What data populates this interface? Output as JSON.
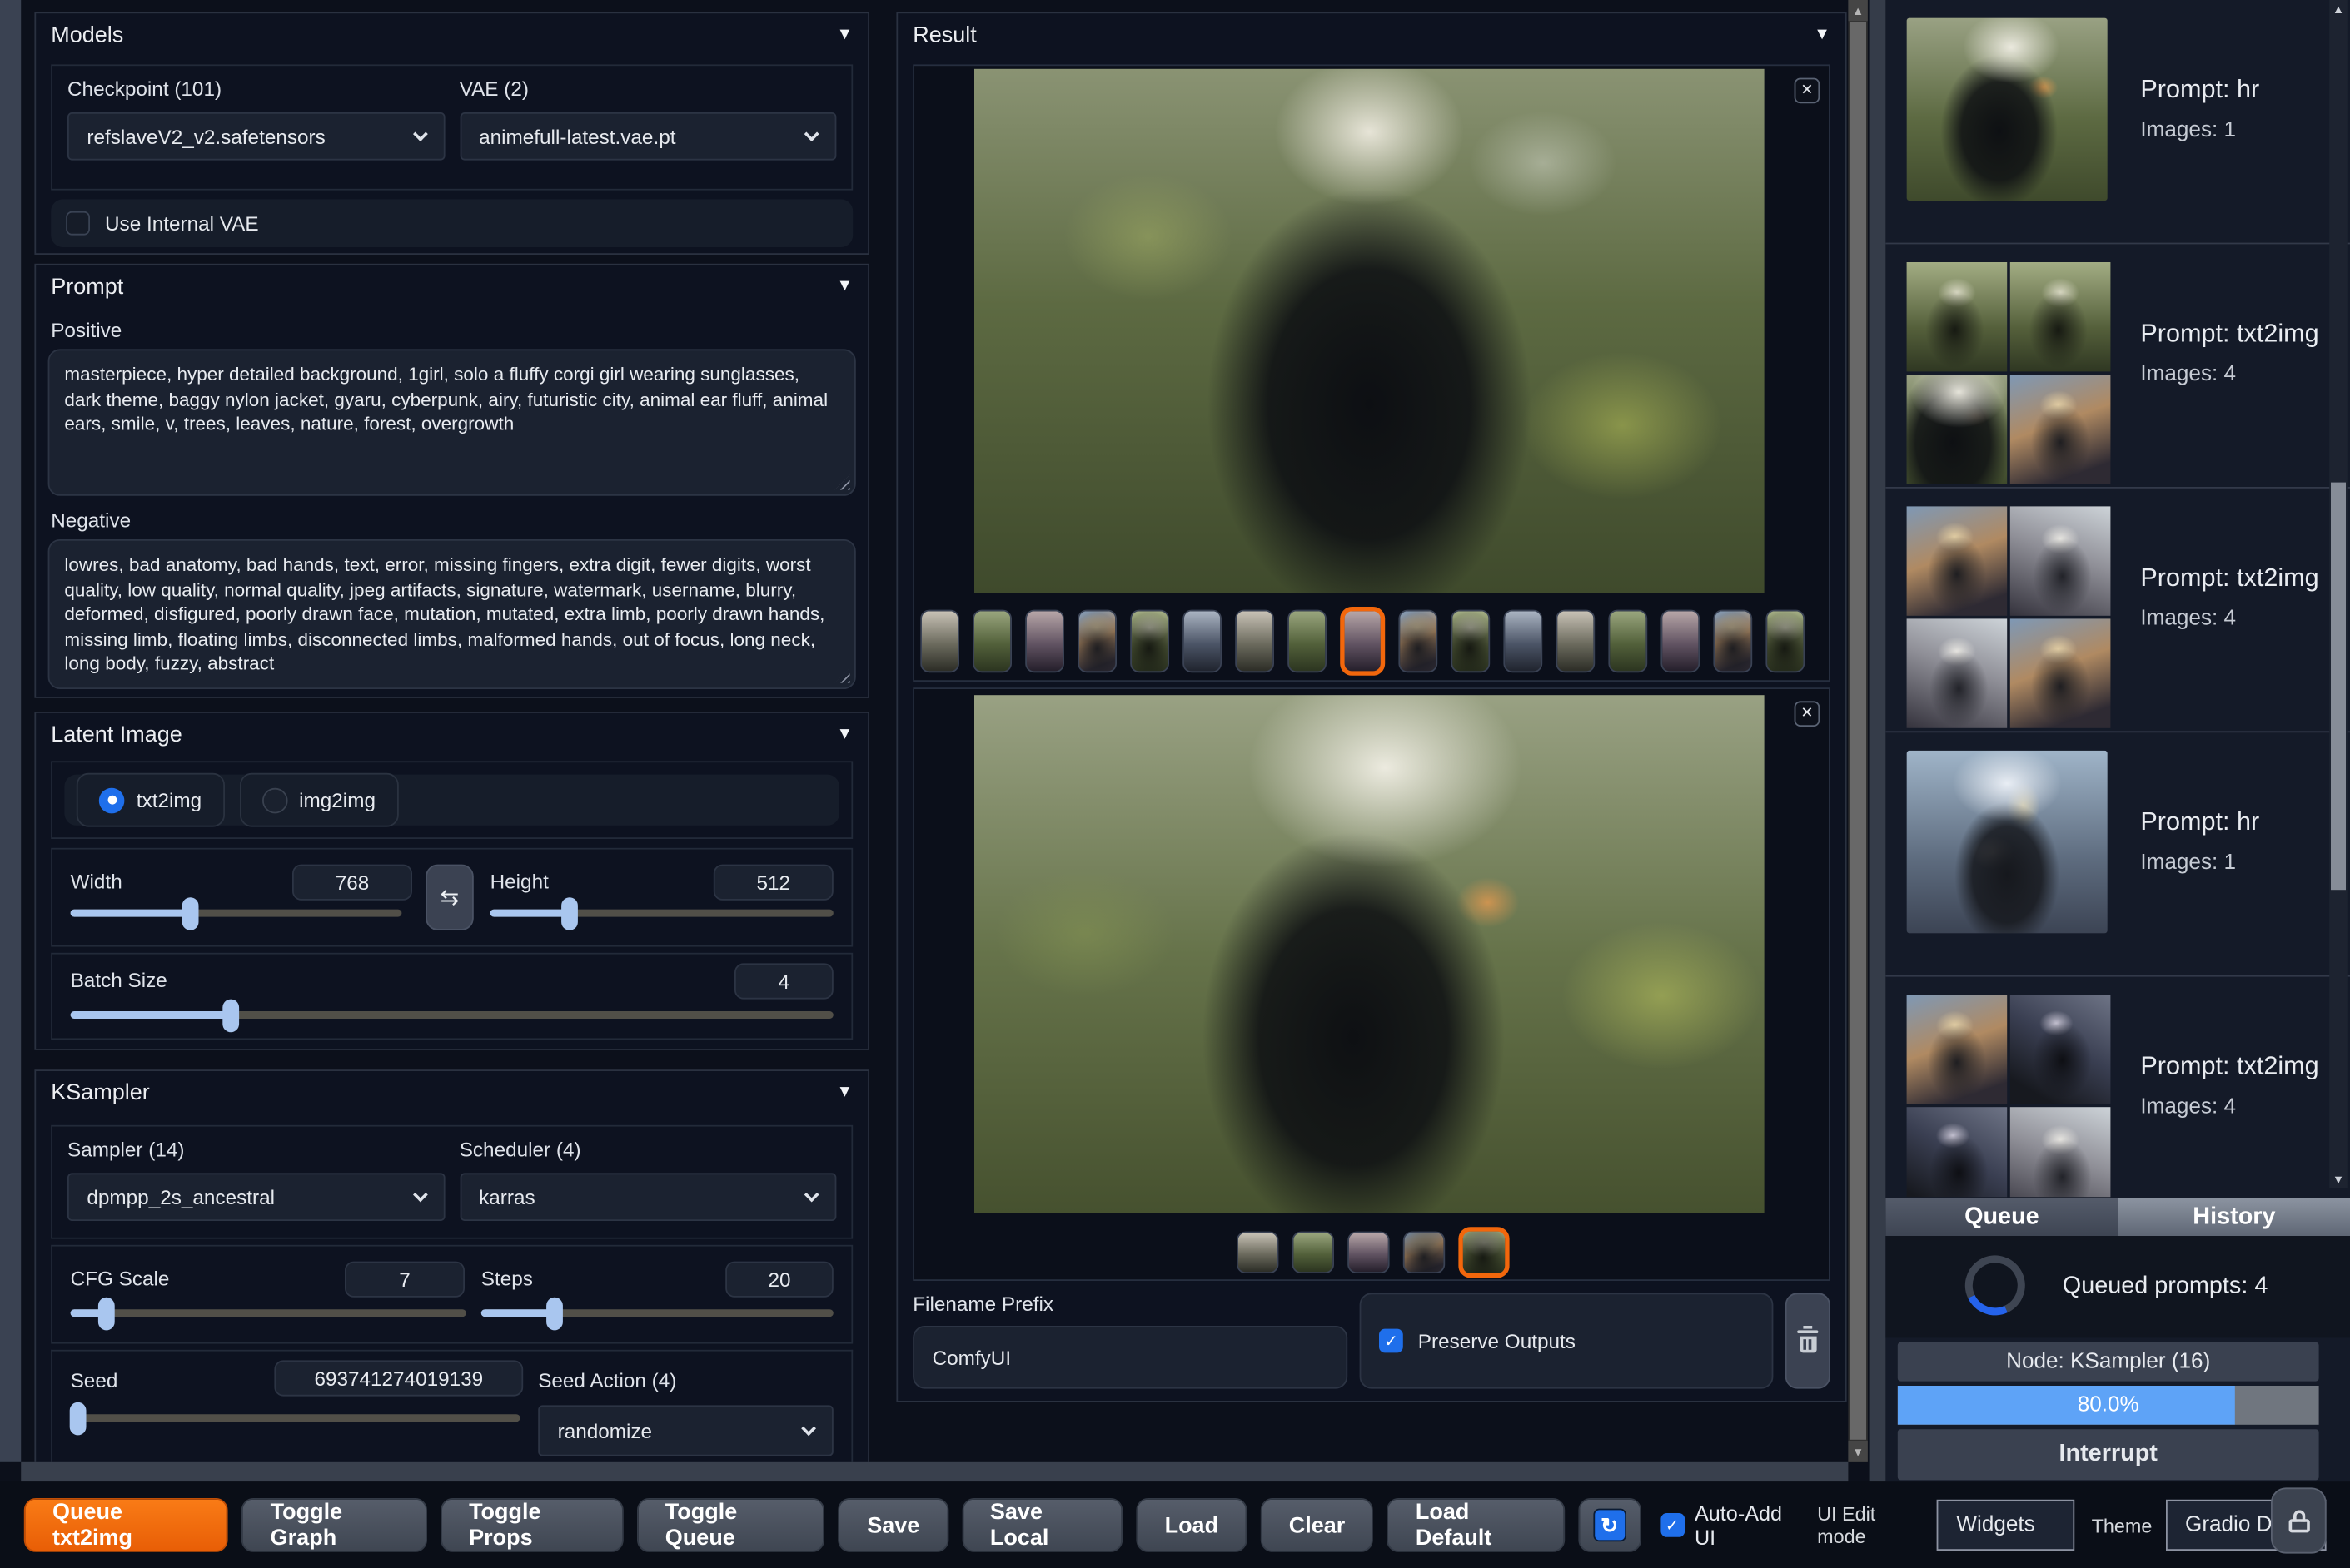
{
  "left_panel": {
    "models": {
      "title": "Models",
      "checkpoint_label": "Checkpoint (101)",
      "checkpoint_value": "refslaveV2_v2.safetensors",
      "vae_label": "VAE (2)",
      "vae_value": "animefull-latest.vae.pt",
      "use_internal_vae_label": "Use Internal VAE",
      "use_internal_vae_checked": false
    },
    "prompt": {
      "title": "Prompt",
      "positive_label": "Positive",
      "positive_value": "masterpiece, hyper detailed background, 1girl, solo a fluffy corgi girl wearing sunglasses, dark theme, baggy nylon jacket, gyaru, cyberpunk, airy, futuristic city, animal ear fluff, animal ears, smile, v, trees, leaves, nature, forest, overgrowth",
      "negative_label": "Negative",
      "negative_value": "lowres, bad anatomy, bad hands, text, error, missing fingers, extra digit, fewer digits, worst quality, low quality, normal quality, jpeg artifacts, signature, watermark, username, blurry, deformed, disfigured, poorly drawn face, mutation, mutated, extra limb, poorly drawn hands, missing limb, floating limbs, disconnected limbs, malformed hands, out of focus, long neck, long body, fuzzy, abstract"
    },
    "latent": {
      "title": "Latent Image",
      "mode_txt2img": "txt2img",
      "mode_img2img": "img2img",
      "selected_mode": "txt2img",
      "width_label": "Width",
      "width_value": "768",
      "height_label": "Height",
      "height_value": "512",
      "batch_label": "Batch Size",
      "batch_value": "4"
    },
    "ksampler": {
      "title": "KSampler",
      "sampler_label": "Sampler (14)",
      "sampler_value": "dpmpp_2s_ancestral",
      "scheduler_label": "Scheduler (4)",
      "scheduler_value": "karras",
      "cfg_label": "CFG Scale",
      "cfg_value": "7",
      "steps_label": "Steps",
      "steps_value": "20",
      "seed_label": "Seed",
      "seed_value": "693741274019139",
      "seed_action_label": "Seed Action (4)",
      "seed_action_value": "randomize"
    }
  },
  "result_panel": {
    "title": "Result",
    "close_label": "✕",
    "gallery1": {
      "thumb_count": 17,
      "selected_index": 9
    },
    "gallery2": {
      "thumb_count": 5,
      "selected_index": 5
    },
    "filename_prefix_label": "Filename Prefix",
    "filename_prefix_value": "ComfyUI",
    "preserve_outputs_label": "Preserve Outputs",
    "preserve_outputs_checked": true
  },
  "history_panel": {
    "items": [
      {
        "prompt": "Prompt: hr",
        "images": "Images: 1",
        "layout": "single",
        "art": "art-s1"
      },
      {
        "prompt": "Prompt: txt2img",
        "images": "Images: 4",
        "layout": "grid",
        "arts": [
          "art-g3",
          "art-g3",
          "art-s1",
          "art-g1"
        ]
      },
      {
        "prompt": "Prompt: txt2img",
        "images": "Images: 4",
        "layout": "grid",
        "arts": [
          "art-g1",
          "art-g2",
          "art-g2",
          "art-g1"
        ]
      },
      {
        "prompt": "Prompt: hr",
        "images": "Images: 1",
        "layout": "single",
        "art": "art-s2"
      },
      {
        "prompt": "Prompt: txt2img",
        "images": "Images: 4",
        "layout": "grid",
        "arts": [
          "art-g1",
          "art-g4",
          "art-g4",
          "art-g2"
        ]
      }
    ],
    "tab_queue": "Queue",
    "tab_history": "History",
    "active_tab": "History",
    "queued_prompts": "Queued prompts: 4",
    "node_status": "Node: KSampler (16)",
    "progress_text": "80.0%",
    "progress_value": 80,
    "interrupt_label": "Interrupt"
  },
  "bottom_bar": {
    "queue_button": "Queue txt2img",
    "buttons": [
      "Toggle Graph",
      "Toggle Props",
      "Toggle Queue",
      "Save",
      "Save Local",
      "Load",
      "Clear",
      "Load Default"
    ],
    "refresh_glyph": "↻",
    "auto_add_ui_label": "Auto-Add UI",
    "auto_add_ui_checked": true,
    "ui_edit_mode_label": "UI Edit mode",
    "ui_edit_mode_value": "Widgets",
    "theme_label": "Theme",
    "theme_value": "Gradio Dark"
  },
  "colors": {
    "accent_orange": "#f2670c",
    "accent_blue": "#1f6feb",
    "slider_blue": "#a9c6ef",
    "progress_blue": "#5ea3f7",
    "panel_bg": "#141a28",
    "page_bg": "#0c101b"
  }
}
